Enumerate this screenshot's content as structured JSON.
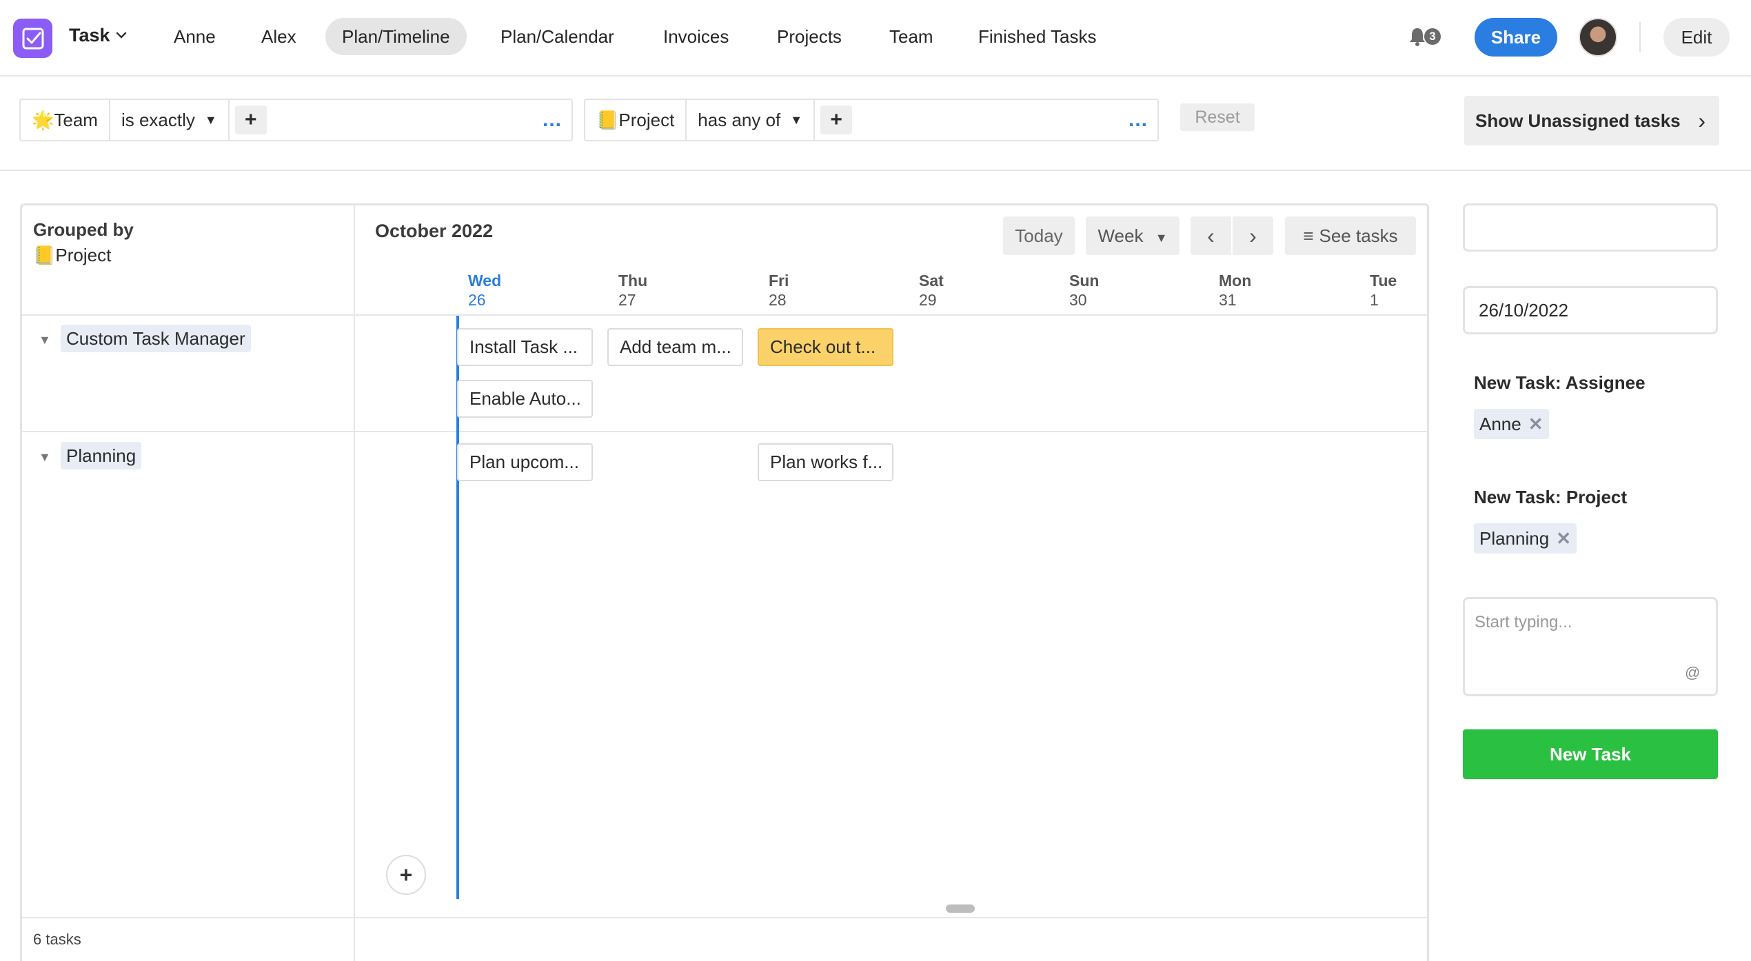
{
  "app": {
    "name": "Task",
    "accent_color": "#8b5cf6"
  },
  "nav": {
    "tabs": [
      {
        "label": "Anne"
      },
      {
        "label": "Alex"
      },
      {
        "label": "Plan/Timeline",
        "active": true
      },
      {
        "label": "Plan/Calendar"
      },
      {
        "label": "Invoices"
      },
      {
        "label": "Projects"
      },
      {
        "label": "Team"
      },
      {
        "label": "Finished Tasks"
      }
    ],
    "notification_count": "3",
    "share_label": "Share",
    "edit_label": "Edit",
    "share_color": "#2a7de1"
  },
  "filters": [
    {
      "field": "🌟Team",
      "operator": "is exactly",
      "add": "+",
      "more": "..."
    },
    {
      "field": "📒Project",
      "operator": "has any of",
      "add": "+",
      "more": "..."
    }
  ],
  "filter_reset_label": "Reset",
  "show_unassigned_label": "Show Unassigned tasks",
  "timeline": {
    "grouped_by_label": "Grouped by",
    "grouped_by_field": "📒Project",
    "month": "October 2022",
    "today_label": "Today",
    "range_label": "Week",
    "see_tasks_label": "See tasks",
    "days": [
      {
        "name": "Wed",
        "num": "26",
        "today": true
      },
      {
        "name": "Thu",
        "num": "27"
      },
      {
        "name": "Fri",
        "num": "28"
      },
      {
        "name": "Sat",
        "num": "29"
      },
      {
        "name": "Sun",
        "num": "30"
      },
      {
        "name": "Mon",
        "num": "31"
      },
      {
        "name": "Tue",
        "num": "1"
      }
    ],
    "groups": [
      {
        "name": "Custom Task Manager",
        "tasks": [
          {
            "title": "Install Task ...",
            "day": "Wed"
          },
          {
            "title": "Add team m...",
            "day": "Thu"
          },
          {
            "title": "Check out t...",
            "day": "Fri",
            "highlight": "#fbd26a"
          },
          {
            "title": "Enable Auto...",
            "day": "Wed"
          }
        ]
      },
      {
        "name": "Planning",
        "tasks": [
          {
            "title": "Plan upcom...",
            "day": "Wed"
          },
          {
            "title": "Plan works f...",
            "day": "Fri"
          }
        ]
      }
    ],
    "task_count": "6 tasks"
  },
  "new_task_panel": {
    "title_value": "",
    "date_value": "26/10/2022",
    "assignee_label": "New Task: Assignee",
    "assignee": "Anne",
    "project_label": "New Task: Project",
    "project": "Planning",
    "notes_placeholder": "Start typing...",
    "mention_symbol": "@",
    "submit_label": "New Task",
    "submit_color": "#2ac041"
  }
}
